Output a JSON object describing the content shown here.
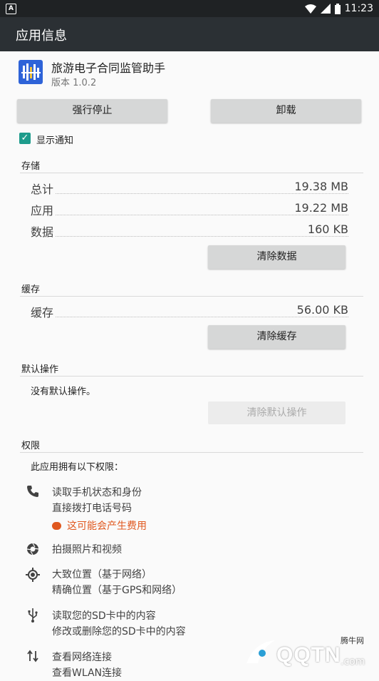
{
  "status_bar": {
    "notification_icon": "A",
    "time": "11:23",
    "icons": [
      "wifi-icon",
      "signal-icon",
      "battery-icon"
    ]
  },
  "appbar": {
    "title": "应用信息"
  },
  "app": {
    "name": "旅游电子合同监管助手",
    "version": "版本 1.0.2"
  },
  "actions": {
    "force_stop": "强行停止",
    "uninstall": "卸载"
  },
  "notification_checkbox": {
    "label": "显示通知",
    "checked": true
  },
  "storage": {
    "title": "存储",
    "rows": [
      {
        "label": "总计",
        "value": "19.38 MB"
      },
      {
        "label": "应用",
        "value": "19.22 MB"
      },
      {
        "label": "数据",
        "value": "160 KB"
      }
    ],
    "clear_button": "清除数据"
  },
  "cache": {
    "title": "缓存",
    "rows": [
      {
        "label": "缓存",
        "value": "56.00 KB"
      }
    ],
    "clear_button": "清除缓存"
  },
  "defaults": {
    "title": "默认操作",
    "text": "没有默认操作。",
    "clear_button": "清除默认操作"
  },
  "permissions": {
    "title": "权限",
    "intro": "此应用拥有以下权限：",
    "groups": [
      {
        "icon": "phone-icon",
        "lines": [
          "读取手机状态和身份",
          "直接拨打电话号码"
        ],
        "cost": "这可能会产生费用"
      },
      {
        "icon": "camera-icon",
        "lines": [
          "拍摄照片和视频"
        ]
      },
      {
        "icon": "location-icon",
        "lines": [
          "大致位置（基于网络）",
          "精确位置（基于GPS和网络）"
        ]
      },
      {
        "icon": "usb-icon",
        "lines": [
          "读取您的SD卡中的内容",
          "修改或删除您的SD卡中的内容"
        ]
      },
      {
        "icon": "network-arrows-icon",
        "lines": [
          "查看网络连接",
          "查看WLAN连接"
        ]
      }
    ]
  },
  "watermark": {
    "text": "QQTN",
    "suffix": ".com",
    "tag": "腾牛网"
  },
  "colors": {
    "accent": "#1e9c8c",
    "appbar": "#2b3034",
    "statusbar": "#1f2224",
    "warning": "#e0581f"
  }
}
